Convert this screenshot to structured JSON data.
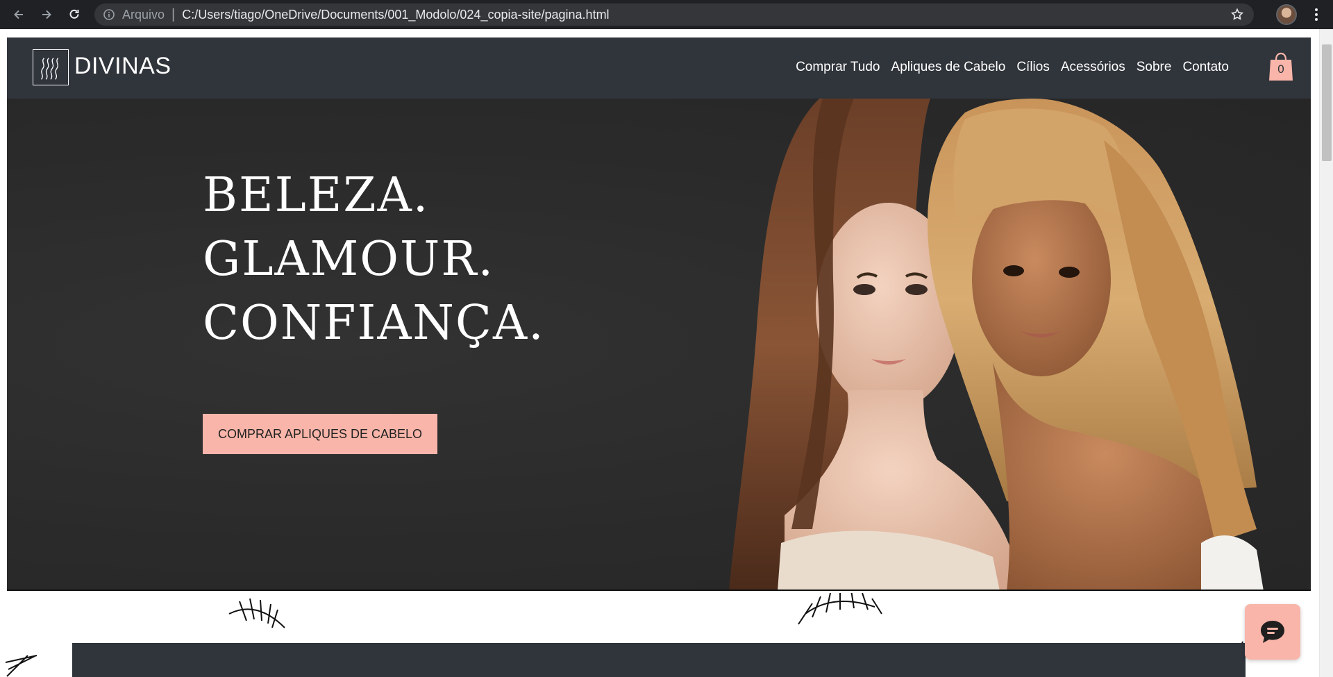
{
  "browser": {
    "scheme_label": "Arquivo",
    "url": "C:/Users/tiago/OneDrive/Documents/001_Modolo/024_copia-site/pagina.html",
    "icons": [
      "back-arrow-icon",
      "forward-arrow-icon",
      "reload-icon",
      "info-icon",
      "star-icon",
      "profile-avatar",
      "more-menu-icon"
    ]
  },
  "site": {
    "brand": "DIVINAS",
    "nav": [
      "Comprar Tudo",
      "Apliques de Cabelo",
      "Cílios",
      "Acessórios",
      "Sobre",
      "Contato"
    ],
    "cart_count": "0"
  },
  "hero": {
    "lines": [
      "BELEZA.",
      "GLAMOUR.",
      "CONFIANÇA."
    ],
    "cta": "COMPRAR APLIQUES DE CABELO"
  },
  "colors": {
    "header_bg": "#30343b",
    "accent_pink": "#f9b5a9",
    "hero_bg": "#2a2a2a",
    "chrome_bg": "#202124"
  }
}
